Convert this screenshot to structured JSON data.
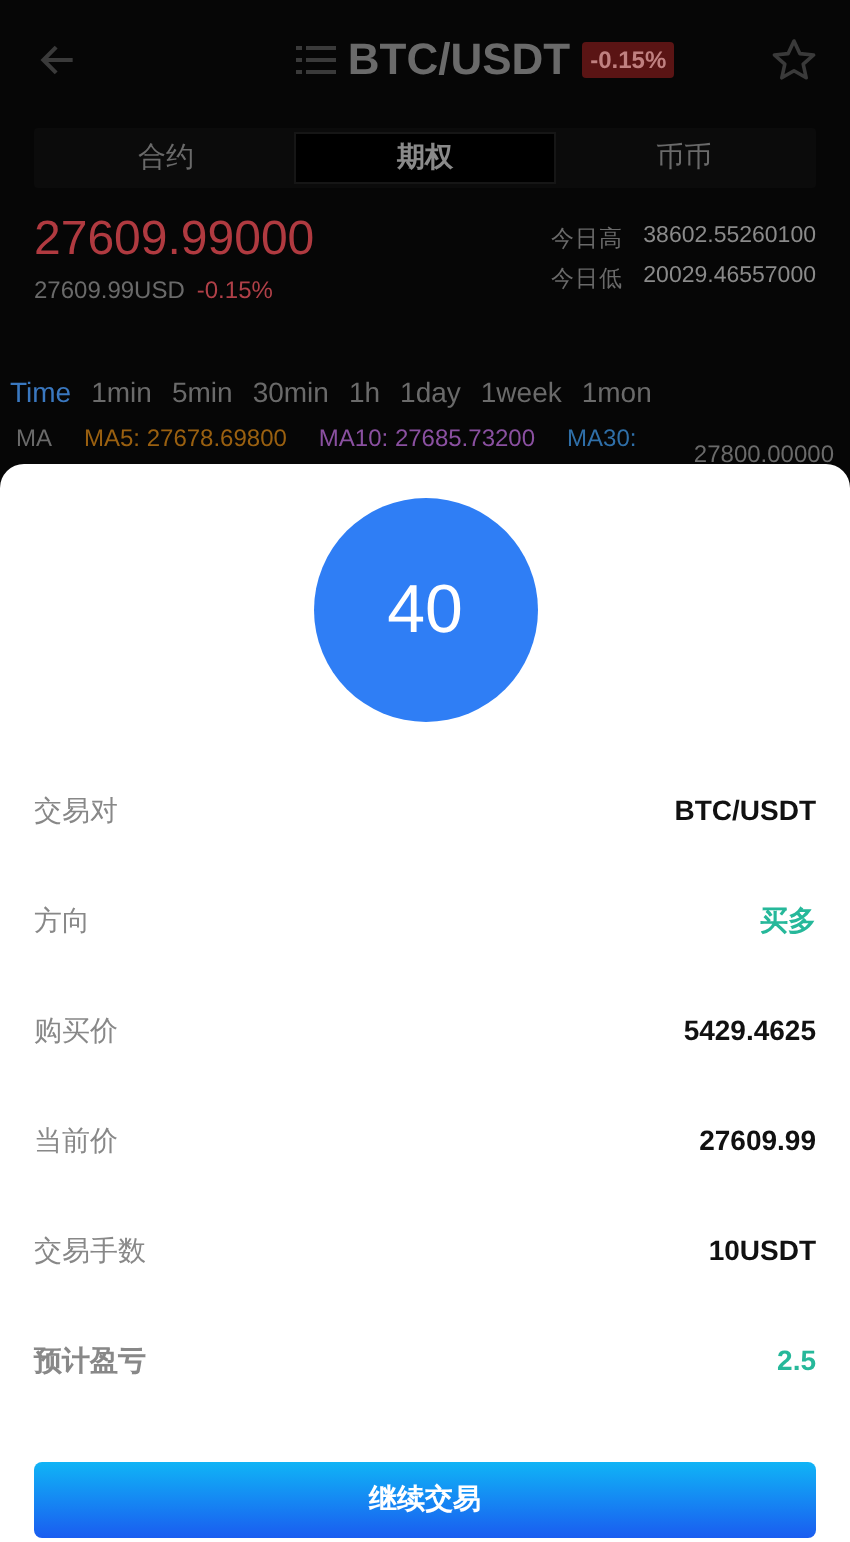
{
  "header": {
    "title": "BTC/USDT",
    "change": "-0.15%"
  },
  "tabs": [
    {
      "label": "合约",
      "selected": false
    },
    {
      "label": "期权",
      "selected": true
    },
    {
      "label": "币币",
      "selected": false
    }
  ],
  "price": {
    "last": "27609.99000",
    "usd": "27609.99USD",
    "change": "-0.15%",
    "stats": [
      {
        "label": "今日高",
        "value": "38602.55260100"
      },
      {
        "label": "今日低",
        "value": "20029.46557000"
      }
    ]
  },
  "timeframes": [
    {
      "label": "Time",
      "selected": true
    },
    {
      "label": "1min",
      "selected": false
    },
    {
      "label": "5min",
      "selected": false
    },
    {
      "label": "30min",
      "selected": false
    },
    {
      "label": "1h",
      "selected": false
    },
    {
      "label": "1day",
      "selected": false
    },
    {
      "label": "1week",
      "selected": false
    },
    {
      "label": "1mon",
      "selected": false
    }
  ],
  "ma": {
    "label": "MA",
    "lines": [
      {
        "text": "MA5: 27678.69800",
        "color": "#9a6010"
      },
      {
        "text": "MA10: 27685.73200",
        "color": "#8a50a0"
      },
      {
        "text": "MA30:",
        "color": "#2f6fa8"
      }
    ],
    "axis_label": "27800.00000"
  },
  "sheet": {
    "countdown": "40",
    "rows": [
      {
        "label": "交易对",
        "value": "BTC/USDT",
        "color": "#111111",
        "emphasis": false
      },
      {
        "label": "方向",
        "value": "买多",
        "color": "#26b89a",
        "emphasis": false
      },
      {
        "label": "购买价",
        "value": "5429.4625",
        "color": "#111111",
        "emphasis": false
      },
      {
        "label": "当前价",
        "value": "27609.99",
        "color": "#111111",
        "emphasis": false
      },
      {
        "label": "交易手数",
        "value": "10USDT",
        "color": "#111111",
        "emphasis": false
      },
      {
        "label": "预计盈亏",
        "value": "2.5",
        "color": "#26b89a",
        "emphasis": true
      }
    ],
    "button": "继续交易"
  }
}
